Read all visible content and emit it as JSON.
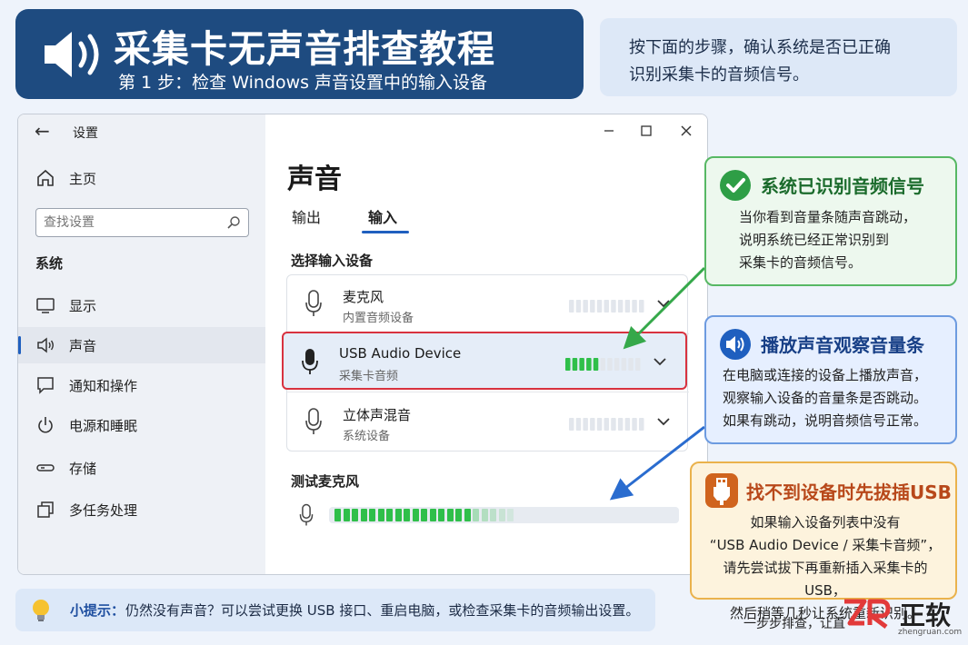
{
  "header": {
    "title": "采集卡无声音排查教程",
    "subtitle": "第 1 步：检查 Windows 声音设置中的输入设备"
  },
  "intro": {
    "line1": "按下面的步骤，确认系统是否已正确",
    "line2": "识别采集卡的音频信号。"
  },
  "window": {
    "title": "设置",
    "sidebar": {
      "home": "主页",
      "search_placeholder": "查找设置",
      "section": "系统",
      "items": [
        {
          "label": "显示",
          "icon": "monitor-icon"
        },
        {
          "label": "声音",
          "icon": "speaker-icon",
          "active": true
        },
        {
          "label": "通知和操作",
          "icon": "notification-icon"
        },
        {
          "label": "电源和睡眠",
          "icon": "power-icon"
        },
        {
          "label": "存储",
          "icon": "storage-icon"
        },
        {
          "label": "多任务处理",
          "icon": "multitask-icon"
        }
      ]
    },
    "content": {
      "heading": "声音",
      "tabs": [
        {
          "label": "输出",
          "active": false
        },
        {
          "label": "输入",
          "active": true
        }
      ],
      "choose_device_label": "选择输入设备",
      "devices": [
        {
          "name": "麦克风",
          "description": "内置音频设备",
          "level": 0,
          "selected": false
        },
        {
          "name": "USB Audio Device",
          "description": "采集卡音频",
          "level": 0.45,
          "selected": true
        },
        {
          "name": "立体声混音",
          "description": "系统设备",
          "level": 0,
          "selected": false
        }
      ],
      "test_label": "测试麦克风",
      "test_level": 0.4
    }
  },
  "callouts": {
    "recognized": {
      "title": "系统已识别音频信号",
      "lines": [
        "当你看到音量条随声音跳动，",
        "说明系统已经正常识别到",
        "采集卡的音频信号。"
      ],
      "color": "#2e9e46"
    },
    "play_sound": {
      "title": "播放声音观察音量条",
      "lines": [
        "在电脑或连接的设备上播放声音，",
        "观察输入设备的音量条是否跳动。",
        "如果有跳动，说明音频信号正常。"
      ],
      "color": "#1f5fbf"
    },
    "replug": {
      "title": "找不到设备时先拔插USB",
      "lines": [
        "如果输入设备列表中没有",
        "“USB Audio Device / 采集卡音频”，",
        "请先尝试拔下再重新插入采集卡的 USB，",
        "然后稍等几秒让系统重新识别。"
      ],
      "color": "#d0641e"
    }
  },
  "tip": {
    "label": "小提示：",
    "text": "仍然没有声音？可以尝试更换 USB 接口、重启电脑，或检查采集卡的音频输出设置。"
  },
  "footer": {
    "text": "一步步排查，让直",
    "brand_logo": "ZR",
    "brand_name": "正软",
    "brand_url": "zhengruan.com"
  },
  "colors": {
    "accent": "#1f5fbf",
    "meter_active": "#2fbf4a",
    "selected_border": "#d8323f"
  }
}
